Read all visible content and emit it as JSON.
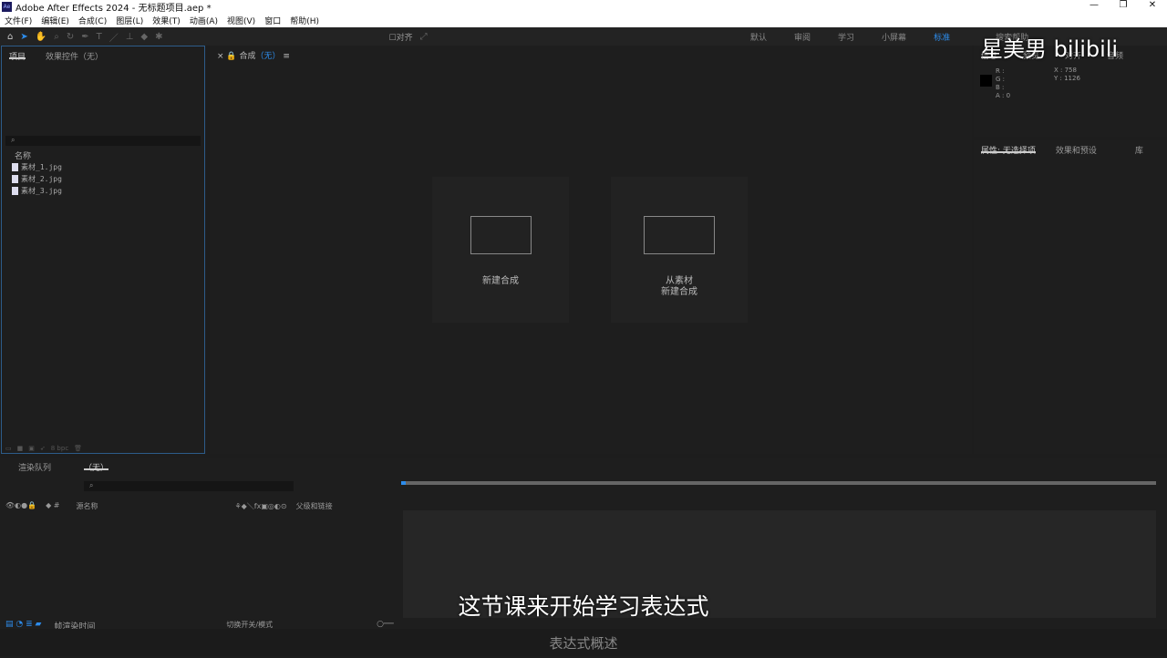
{
  "titlebar": {
    "title": "Adobe After Effects 2024 - 无标题项目.aep *",
    "logo": "Ae",
    "minimize": "—",
    "restore": "❐",
    "close": "✕"
  },
  "menu": [
    "文件(F)",
    "编辑(E)",
    "合成(C)",
    "图层(L)",
    "效果(T)",
    "动画(A)",
    "视图(V)",
    "窗口",
    "帮助(H)"
  ],
  "toolbar": {
    "align": "对齐",
    "workspaces": [
      "默认",
      "审阅",
      "学习",
      "小屏幕",
      "标准"
    ],
    "active_workspace": "标准",
    "search_help": "搜索帮助"
  },
  "project": {
    "tabs": [
      "项目",
      "效果控件（无）"
    ],
    "column": "名称",
    "files": [
      "素材_1.jpg",
      "素材_2.jpg",
      "素材_3.jpg"
    ],
    "bpc": "8 bpc"
  },
  "composition": {
    "tab": "合成",
    "tab_state": "（无）",
    "new_comp": "新建合成",
    "from_footage_1": "从素材",
    "from_footage_2": "新建合成"
  },
  "info": {
    "tabs": [
      "信息",
      "预览",
      "对齐",
      "音频"
    ],
    "r": "R :",
    "g": "G :",
    "b": "B :",
    "a": "A : 0",
    "x": "X : 758",
    "y": "Y : 1126"
  },
  "properties": {
    "tabs": [
      "属性: 无选择项",
      "效果和预设",
      "库"
    ]
  },
  "timeline": {
    "tabs": [
      "渲染队列",
      "（无）"
    ],
    "source_name": "源名称",
    "parent": "父级和链接",
    "render_time": "帧渲染时间",
    "toggle": "切换开关/模式"
  },
  "overlay": {
    "subtitle": "这节课来开始学习表达式",
    "watermark": "星美男  bilibili",
    "chapter": "表达式概述"
  },
  "colors": {
    "accent": "#2d8ceb"
  }
}
